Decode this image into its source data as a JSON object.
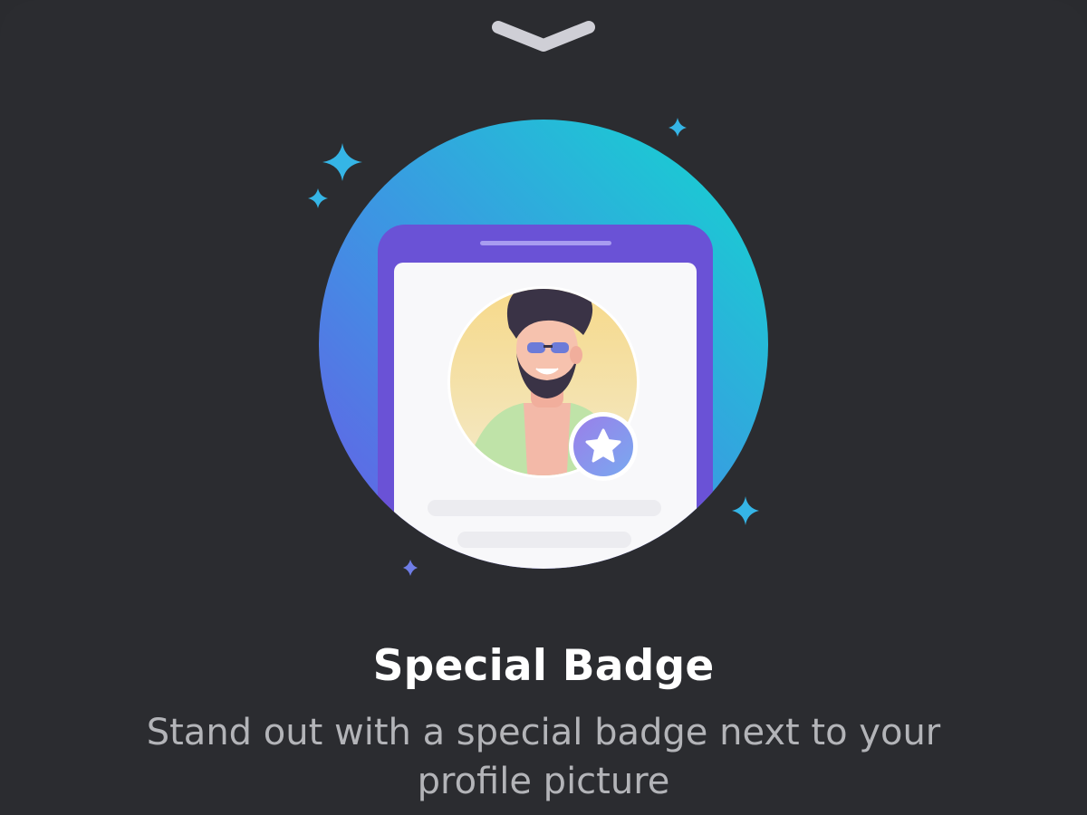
{
  "feature": {
    "title": "Special Badge",
    "description": "Stand out with a special badge next to your profile picture"
  },
  "icons": {
    "grabber": "chevron-down-icon",
    "badge": "star-icon",
    "sparkle": "sparkle-icon"
  },
  "colors": {
    "background": "#2b2c30",
    "title": "#ffffff",
    "description": "#b3b4b8",
    "circle_gradient_start": "#6a5ae6",
    "circle_gradient_end": "#15d6d2",
    "phone_frame": "#6a52d6",
    "sparkle": "#35b5e6",
    "badge": "#7f8ff0"
  }
}
